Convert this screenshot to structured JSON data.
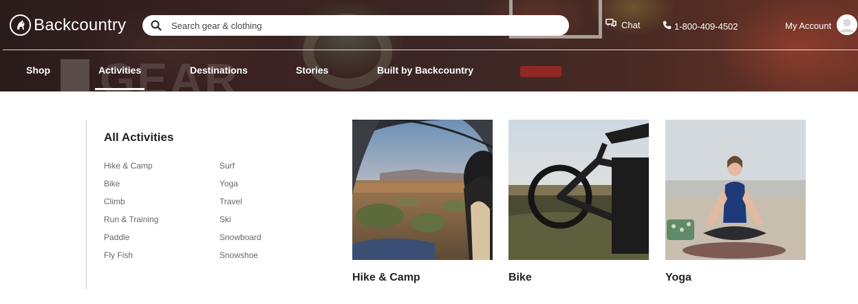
{
  "header": {
    "logo_text": "Backcountry",
    "search_placeholder": "Search gear & clothing",
    "chat_label": "Chat",
    "phone_label": "1-800-409-4502",
    "account_label": "My Account"
  },
  "nav": {
    "items": [
      {
        "label": "Shop"
      },
      {
        "label": "Activities",
        "active": true
      },
      {
        "label": "Destinations"
      },
      {
        "label": "Stories"
      },
      {
        "label": "Built by Backcountry"
      }
    ]
  },
  "menu": {
    "title": "All Activities",
    "column_1": [
      "Hike & Camp",
      "Bike",
      "Climb",
      "Run & Training",
      "Paddle",
      "Fly Fish"
    ],
    "column_2": [
      "Surf",
      "Yoga",
      "Travel",
      "Ski",
      "Snowboard",
      "Snowshoe"
    ]
  },
  "featured": [
    {
      "title": "Hike & Camp"
    },
    {
      "title": "Bike"
    },
    {
      "title": "Yoga"
    }
  ],
  "colors": {
    "header_bg": "#3a2321",
    "text_primary": "#222222",
    "link_text": "#666666",
    "accent": "#ffffff"
  }
}
